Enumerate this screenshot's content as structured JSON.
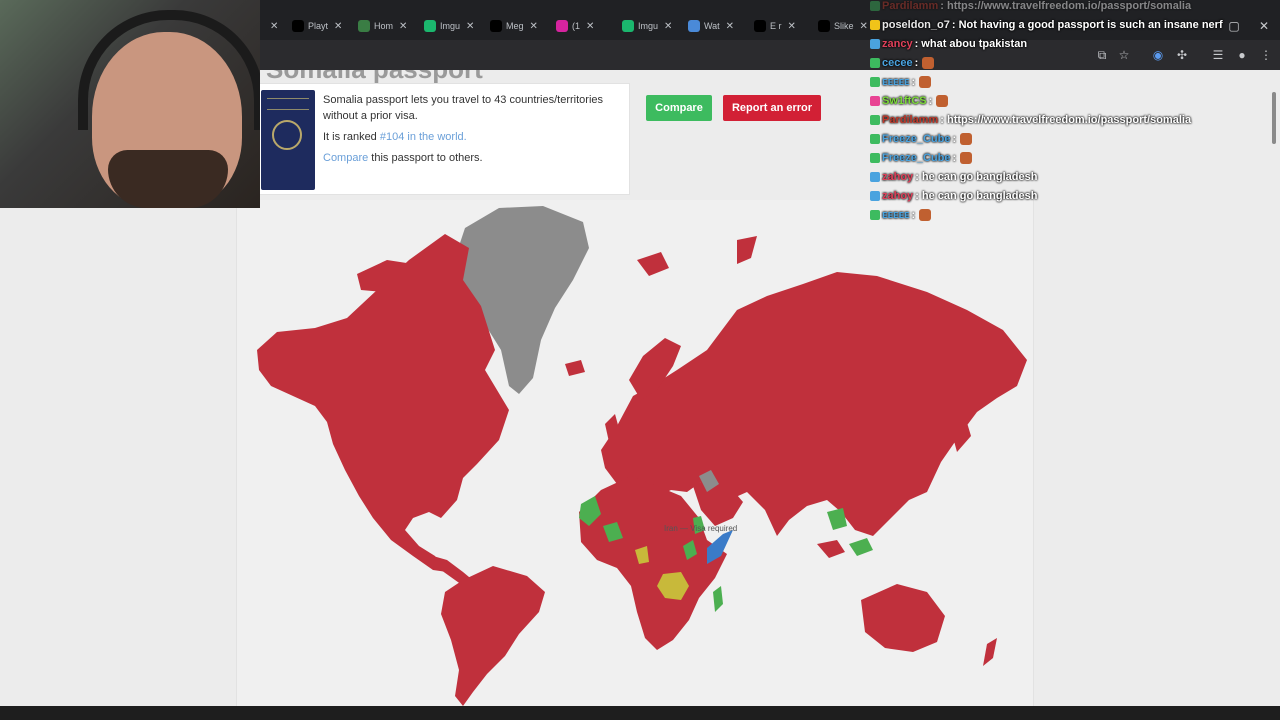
{
  "browser": {
    "tabs": [
      {
        "label": "Playt",
        "icon": "x-logo-icon",
        "color": "#000000"
      },
      {
        "label": "Hom",
        "icon": "leaf-icon",
        "color": "#3a7d44"
      },
      {
        "label": "Imgu",
        "icon": "imgur-icon",
        "color": "#1bb76e"
      },
      {
        "label": "Meg",
        "icon": "x-logo-icon",
        "color": "#000000"
      },
      {
        "label": "(1",
        "icon": "instagram-icon",
        "color": "#d6249f"
      },
      {
        "label": "Imgu",
        "icon": "imgur-icon",
        "color": "#1bb76e"
      },
      {
        "label": "Wat",
        "icon": "watch-icon",
        "color": "#4a8ad8"
      },
      {
        "label": "E r",
        "icon": "x-logo-icon",
        "color": "#000000"
      },
      {
        "label": "Slike",
        "icon": "tiktok-icon",
        "color": "#000000"
      }
    ]
  },
  "page": {
    "heading": "Somalia passport",
    "info": {
      "line1": "Somalia passport lets you travel to 43 countries/territories",
      "line2": "without a prior visa.",
      "rank_prefix": "It is ranked ",
      "rank_link": "#104 in the world.",
      "compare_link": "Compare",
      "compare_suffix": " this passport to others."
    },
    "buttons": {
      "compare": "Compare",
      "report": "Report an error"
    },
    "map": {
      "tooltip": "Iran — Visa required",
      "colors": {
        "visa_required": "#c0303c",
        "visa_free": "#4caf50",
        "visa_on_arrival": "#c8b93a",
        "eta": "#3a7bc8",
        "home_or_na": "#8c8c8c"
      }
    }
  },
  "chat": {
    "messages": [
      {
        "user": "Pardilamm",
        "text": ": https://www.travelfreedom.io/passport/somalia",
        "user_color": "#c0392b",
        "badge": "#3dbb5f"
      },
      {
        "user": "poseldon_o7",
        "text": ": Not having a good passport is such an insane nerf",
        "user_color": "#e8e8e8",
        "badge": "#f0c419"
      },
      {
        "user": "zancy",
        "text": ": what abou tpakistan",
        "user_color": "#e0405a",
        "badge": "#4aa3df"
      },
      {
        "user": "cecee",
        "text": ":",
        "user_color": "#4aa3df",
        "badge": "#3dbb5f"
      },
      {
        "user": "ᴇᴇᴇᴇᴇ",
        "text": ":",
        "user_color": "#4aa3df",
        "badge": "#3dbb5f"
      },
      {
        "user": "Sw1ftCS",
        "text": ":",
        "user_color": "#7cdb3a",
        "badge": "#e84393"
      },
      {
        "user": "Pardilamm",
        "text": ": https://www.travelfreedom.io/passport/somalia",
        "user_color": "#c0392b",
        "badge": "#3dbb5f"
      },
      {
        "user": "Freeze_Cube",
        "text": ":",
        "user_color": "#4aa3df",
        "badge": "#3dbb5f"
      },
      {
        "user": "Freeze_Cube",
        "text": ":",
        "user_color": "#4aa3df",
        "badge": "#3dbb5f"
      },
      {
        "user": "zahoy",
        "text": ": he can go bangladesh",
        "user_color": "#e0405a",
        "badge": "#4aa3df"
      },
      {
        "user": "zahoy",
        "text": ": he can go bangladesh",
        "user_color": "#e0405a",
        "badge": "#4aa3df"
      },
      {
        "user": "ᴇᴇᴇᴇᴇ",
        "text": ":",
        "user_color": "#4aa3df",
        "badge": "#3dbb5f"
      }
    ]
  }
}
